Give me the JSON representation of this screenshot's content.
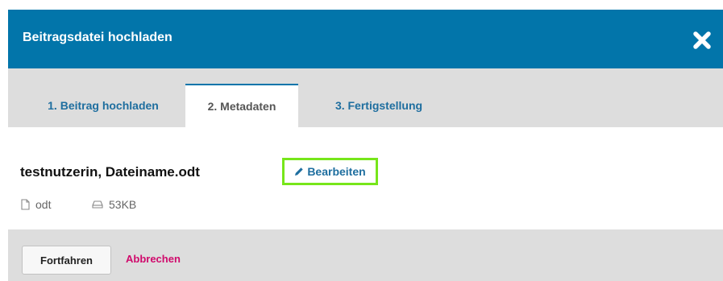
{
  "header": {
    "title": "Beitragsdatei hochladen"
  },
  "tabs": [
    {
      "label": "1. Beitrag hochladen"
    },
    {
      "label": "2. Metadaten",
      "active": true
    },
    {
      "label": "3. Fertigstellung"
    }
  ],
  "file": {
    "name": "testnutzerin, Dateiname.odt",
    "edit_label": "Bearbeiten",
    "type": "odt",
    "size": "53KB"
  },
  "footer": {
    "continue_label": "Fortfahren",
    "cancel_label": "Abbrechen"
  },
  "colors": {
    "header_bg": "#0275aa",
    "link": "#1e6e9f",
    "cancel": "#d00a6c",
    "highlight": "#77e61a"
  },
  "icons": {
    "close": "close-icon",
    "edit": "pencil-icon",
    "file_type": "file-icon",
    "file_size": "drive-icon"
  }
}
